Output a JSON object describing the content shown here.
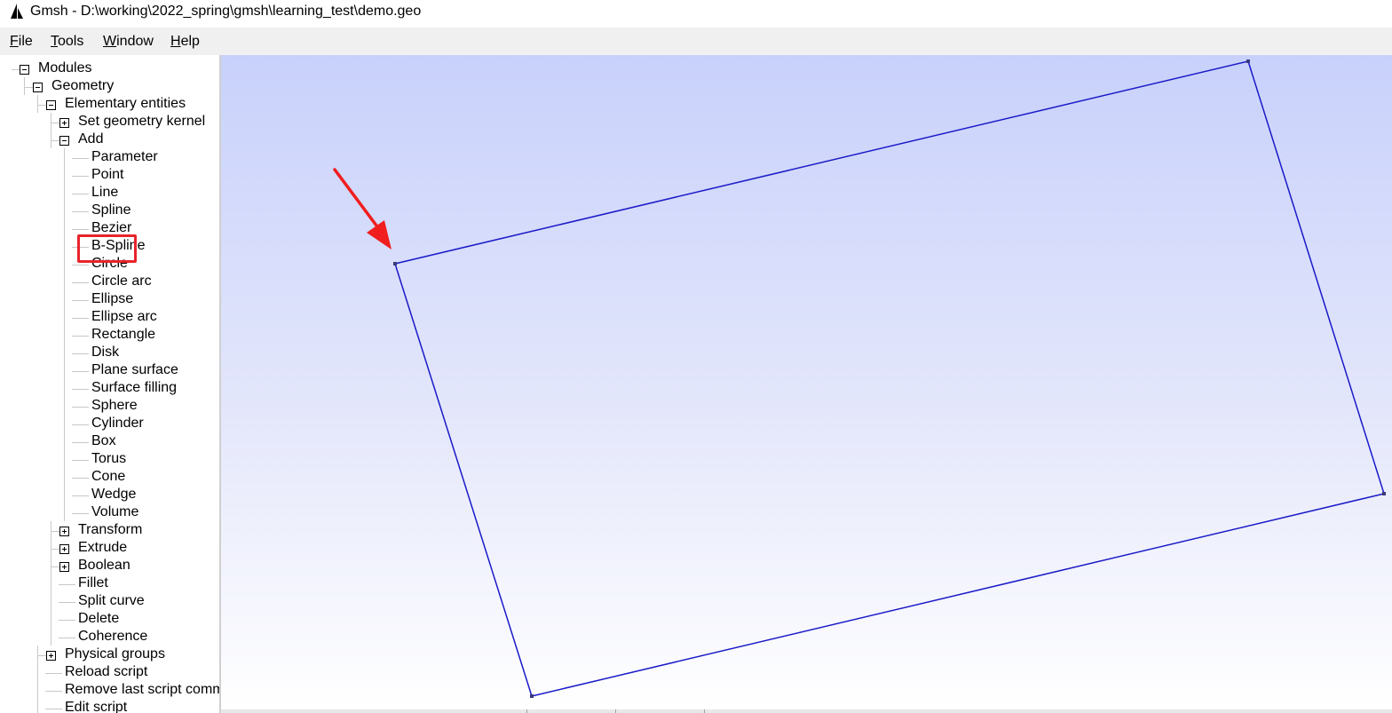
{
  "window": {
    "title": "Gmsh - D:\\working\\2022_spring\\gmsh\\learning_test\\demo.geo"
  },
  "menu": {
    "items": [
      {
        "id": "file",
        "mnemonic": "F",
        "rest": "ile"
      },
      {
        "id": "tools",
        "mnemonic": "T",
        "rest": "ools"
      },
      {
        "id": "window",
        "mnemonic": "W",
        "rest": "indow"
      },
      {
        "id": "help",
        "mnemonic": "H",
        "rest": "elp"
      }
    ]
  },
  "tree": {
    "items": [
      {
        "label": "Modules",
        "level": 0,
        "toggle": "minus"
      },
      {
        "label": "Geometry",
        "level": 1,
        "toggle": "minus"
      },
      {
        "label": "Elementary entities",
        "level": 2,
        "toggle": "minus"
      },
      {
        "label": "Set geometry kernel",
        "level": 3,
        "toggle": "plus"
      },
      {
        "label": "Add",
        "level": 3,
        "toggle": "minus"
      },
      {
        "label": "Parameter",
        "level": 4,
        "toggle": "none"
      },
      {
        "label": "Point",
        "level": 4,
        "toggle": "none"
      },
      {
        "label": "Line",
        "level": 4,
        "toggle": "none",
        "highlighted": true
      },
      {
        "label": "Spline",
        "level": 4,
        "toggle": "none"
      },
      {
        "label": "Bezier",
        "level": 4,
        "toggle": "none"
      },
      {
        "label": "B-Spline",
        "level": 4,
        "toggle": "none"
      },
      {
        "label": "Circle",
        "level": 4,
        "toggle": "none"
      },
      {
        "label": "Circle arc",
        "level": 4,
        "toggle": "none"
      },
      {
        "label": "Ellipse",
        "level": 4,
        "toggle": "none"
      },
      {
        "label": "Ellipse arc",
        "level": 4,
        "toggle": "none"
      },
      {
        "label": "Rectangle",
        "level": 4,
        "toggle": "none"
      },
      {
        "label": "Disk",
        "level": 4,
        "toggle": "none"
      },
      {
        "label": "Plane surface",
        "level": 4,
        "toggle": "none"
      },
      {
        "label": "Surface filling",
        "level": 4,
        "toggle": "none"
      },
      {
        "label": "Sphere",
        "level": 4,
        "toggle": "none"
      },
      {
        "label": "Cylinder",
        "level": 4,
        "toggle": "none"
      },
      {
        "label": "Box",
        "level": 4,
        "toggle": "none"
      },
      {
        "label": "Torus",
        "level": 4,
        "toggle": "none"
      },
      {
        "label": "Cone",
        "level": 4,
        "toggle": "none"
      },
      {
        "label": "Wedge",
        "level": 4,
        "toggle": "none"
      },
      {
        "label": "Volume",
        "level": 4,
        "toggle": "none"
      },
      {
        "label": "Transform",
        "level": 3,
        "toggle": "plus"
      },
      {
        "label": "Extrude",
        "level": 3,
        "toggle": "plus"
      },
      {
        "label": "Boolean",
        "level": 3,
        "toggle": "plus"
      },
      {
        "label": "Fillet",
        "level": 3,
        "toggle": "none"
      },
      {
        "label": "Split curve",
        "level": 3,
        "toggle": "none"
      },
      {
        "label": "Delete",
        "level": 3,
        "toggle": "none"
      },
      {
        "label": "Coherence",
        "level": 3,
        "toggle": "none"
      },
      {
        "label": "Physical groups",
        "level": 2,
        "toggle": "plus"
      },
      {
        "label": "Reload script",
        "level": 2,
        "toggle": "none"
      },
      {
        "label": "Remove last script command",
        "level": 2,
        "toggle": "none"
      },
      {
        "label": "Edit script",
        "level": 2,
        "toggle": "none"
      }
    ]
  },
  "graphic": {
    "background_top": "#c8d1fb",
    "background_bottom": "#ffffff",
    "line_color": "#1a1ac8",
    "point_color": "#3a3a7a",
    "geometry": "rotated rectangle of 4 points and 4 lines"
  },
  "annotation": {
    "highlight_color": "#e8232a",
    "arrow_color": "#f01e1e"
  },
  "icons": {
    "app": "gmsh-app-icon",
    "toggle_plus": "expand-plus-icon",
    "toggle_minus": "collapse-minus-icon"
  }
}
